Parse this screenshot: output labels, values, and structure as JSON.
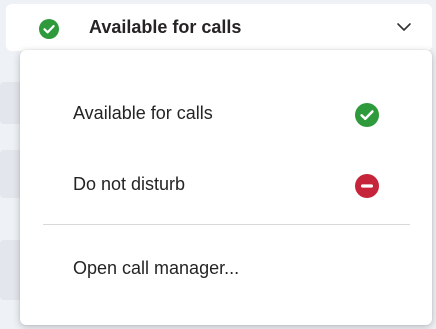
{
  "status_selector": {
    "label": "Available for calls",
    "icon": "check-circle-icon",
    "chevron": "chevron-down-icon"
  },
  "menu": {
    "items": [
      {
        "label": "Available for calls",
        "icon": "check-circle-icon",
        "icon_color": "#2e9a3c"
      },
      {
        "label": "Do not disturb",
        "icon": "minus-circle-icon",
        "icon_color": "#c5243a"
      },
      {
        "label": "Open call manager..."
      }
    ]
  },
  "colors": {
    "available": "#2e9a3c",
    "do_not_disturb": "#c5243a"
  }
}
